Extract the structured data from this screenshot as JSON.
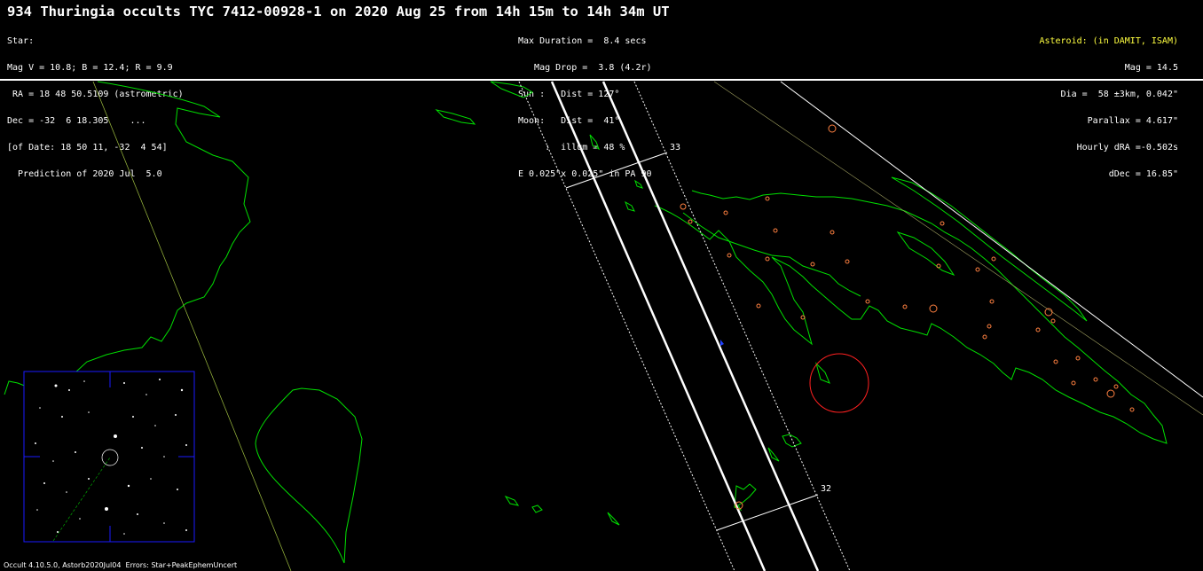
{
  "title": "934 Thuringia occults TYC 7412-00928-1 on 2020 Aug 25 from 14h 15m to 14h 34m UT",
  "star_block": [
    "Star:",
    "Mag V = 10.8; B = 12.4; R = 9.9",
    " RA = 18 48 50.5109 (astrometric)",
    "Dec = -32  6 18.305    ...",
    "[of Date: 18 50 11, -32  4 54]",
    "  Prediction of 2020 Jul  5.0"
  ],
  "mid_block": [
    "Max Duration =  8.4 secs",
    "   Mag Drop =  3.8 (4.2r)",
    "Sun :   Dist = 127°",
    "Moon:   Dist =  41°",
    "     :  illum = 48 %",
    "E 0.025\"x 0.025\" in PA 90"
  ],
  "asteroid_block": {
    "header": "Asteroid: (in DAMIT, ISAM)",
    "lines": [
      "Mag = 14.5",
      "Dia =  58 ±3km, 0.042\"",
      "Parallax = 4.617\"",
      "Hourly dRA =-0.502s",
      "dDec = 16.85\""
    ]
  },
  "labels": {
    "line_33": "33",
    "line_32": "32"
  },
  "footer": "Occult 4.10.5.0, Astorb2020Jul04  Errors: Star+PeakEphemUncert",
  "colors": {
    "background": "#000000",
    "text": "#ffffff",
    "asteroid_header": "#ffff40",
    "coastline": "#00e000",
    "path_lines": "#ffffff",
    "sites": "#ff8040",
    "uncertainty_circle": "#ff2020",
    "inset_frame": "#1a1aff"
  }
}
